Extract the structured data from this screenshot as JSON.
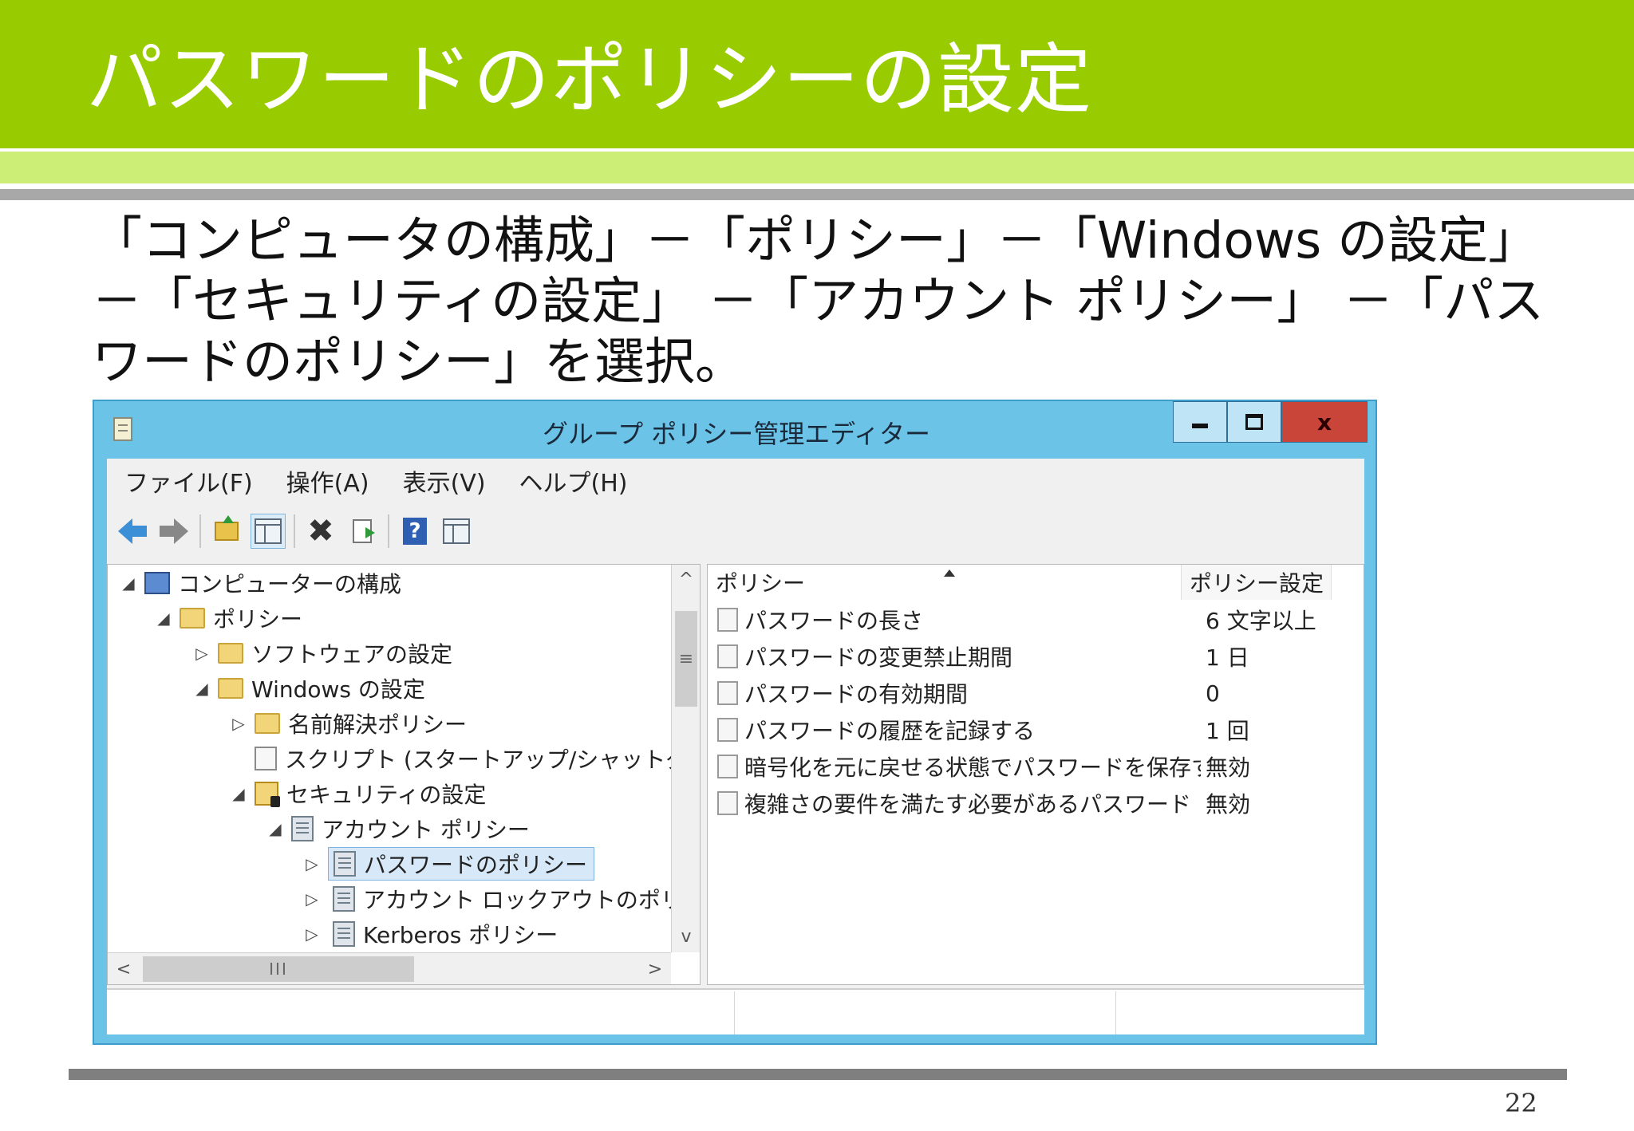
{
  "slide": {
    "title": "パスワードのポリシーの設定",
    "instruction": "「コンピュータの構成」－「ポリシー」－「Windows の設定」－「セキュリティの設定」 －「アカウント ポリシー」 －「パスワードのポリシー」を選択。",
    "page_number": "22",
    "colors": {
      "title_bar": "#99cc00",
      "accent_band": "#ccee77",
      "rule": "#7f7f7f"
    }
  },
  "window": {
    "title": "グループ ポリシー管理エディター",
    "controls": {
      "close": "x"
    },
    "menu": [
      "ファイル(F)",
      "操作(A)",
      "表示(V)",
      "ヘルプ(H)"
    ],
    "toolbar": [
      {
        "icon": "back-arrow-icon"
      },
      {
        "icon": "forward-arrow-icon"
      },
      {
        "icon": "up-folder-icon"
      },
      {
        "icon": "show-hide-console-tree-icon"
      },
      {
        "icon": "delete-icon"
      },
      {
        "icon": "export-list-icon"
      },
      {
        "icon": "help-icon",
        "glyph": "?"
      },
      {
        "icon": "show-action-pane-icon"
      }
    ],
    "tree": [
      {
        "label": "コンピューターの構成",
        "twisty": "◢"
      },
      {
        "label": "ポリシー",
        "twisty": "◢"
      },
      {
        "label": "ソフトウェアの設定",
        "twisty": "▷"
      },
      {
        "label": "Windows の設定",
        "twisty": "◢"
      },
      {
        "label": "名前解決ポリシー",
        "twisty": "▷"
      },
      {
        "label": "スクリプト (スタートアップ/シャットダウン)",
        "twisty": ""
      },
      {
        "label": "セキュリティの設定",
        "twisty": "◢"
      },
      {
        "label": "アカウント ポリシー",
        "twisty": "◢"
      },
      {
        "label": "パスワードのポリシー",
        "twisty": "▷"
      },
      {
        "label": "アカウント ロックアウトのポリシー",
        "twisty": "▷"
      },
      {
        "label": "Kerberos ポリシー",
        "twisty": "▷"
      }
    ],
    "scroll": {
      "up": "^",
      "down": "v",
      "left": "<",
      "right": ">",
      "vgrip": "≡",
      "hgrip": "III"
    },
    "list": {
      "columns": [
        "ポリシー",
        "ポリシー設定"
      ],
      "rows": [
        {
          "name": "パスワードの長さ",
          "value": "6 文字以上"
        },
        {
          "name": "パスワードの変更禁止期間",
          "value": "1 日"
        },
        {
          "name": "パスワードの有効期間",
          "value": "0"
        },
        {
          "name": "パスワードの履歴を記録する",
          "value": "1 回"
        },
        {
          "name": "暗号化を元に戻せる状態でパスワードを保存する",
          "value": "無効"
        },
        {
          "name": "複雑さの要件を満たす必要があるパスワード",
          "value": "無効"
        }
      ]
    }
  }
}
